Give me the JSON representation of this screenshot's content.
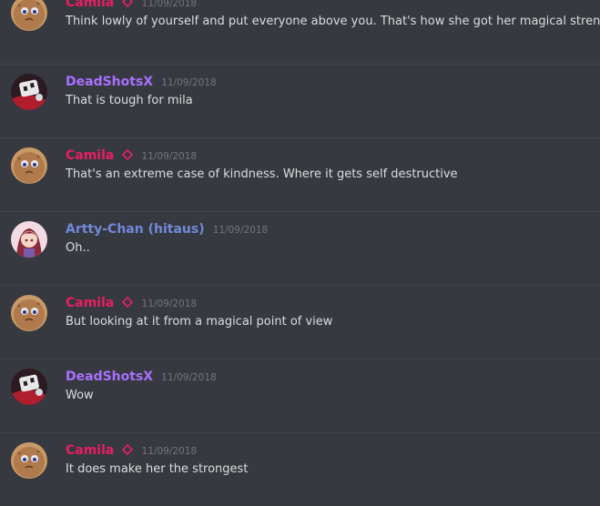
{
  "colors": {
    "background": "#36393f",
    "camila": "#e91e63",
    "deadshotsx": "#a970ff",
    "artty": "#7289da",
    "timestamp": "#72767d",
    "message_text": "#dcddde"
  },
  "messages": [
    {
      "author": "Camila",
      "timestamp": "11/09/2018",
      "text": "Think lowly of yourself and put everyone above you. That's how she got her magical strenght"
    },
    {
      "author": "DeadShotsX",
      "timestamp": "11/09/2018",
      "text": "That is tough for mila"
    },
    {
      "author": "Camila",
      "timestamp": "11/09/2018",
      "text": "That's an extreme case of kindness. Where it gets self destructive"
    },
    {
      "author": "Artty-Chan (hitaus)",
      "timestamp": "11/09/2018",
      "text": "Oh.."
    },
    {
      "author": "Camila",
      "timestamp": "11/09/2018",
      "text": "But looking at it from a magical point of view"
    },
    {
      "author": "DeadShotsX",
      "timestamp": "11/09/2018",
      "text": "Wow"
    },
    {
      "author": "Camila",
      "timestamp": "11/09/2018",
      "text": "It does make her the strongest"
    }
  ]
}
